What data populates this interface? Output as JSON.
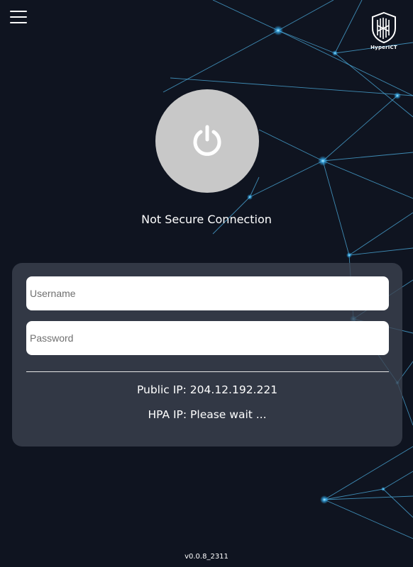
{
  "header": {
    "menu_icon": "hamburger-menu-icon",
    "logo_icon": "shield-logo-icon",
    "logo_text": "HyperICT"
  },
  "connection": {
    "power_icon": "power-icon",
    "status_text": "Not Secure Connection"
  },
  "login": {
    "username_placeholder": "Username",
    "username_value": "",
    "password_placeholder": "Password",
    "password_value": ""
  },
  "network_info": {
    "public_ip": "Public IP: 204.12.192.221",
    "hpa_ip": "HPA IP: Please wait ..."
  },
  "footer": {
    "version": "v0.0.8_2311"
  },
  "colors": {
    "background": "#0f1420",
    "power_button": "#c8c8c8",
    "panel": "#3c4250",
    "network_lines": "#4fb3e6"
  }
}
